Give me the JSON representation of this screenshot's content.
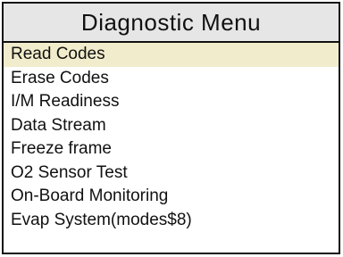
{
  "header": {
    "title": "Diagnostic Menu"
  },
  "menu": {
    "selected_index": 0,
    "items": [
      {
        "label": "Read Codes"
      },
      {
        "label": "Erase Codes"
      },
      {
        "label": "I/M Readiness"
      },
      {
        "label": "Data Stream"
      },
      {
        "label": "Freeze frame"
      },
      {
        "label": "O2 Sensor Test"
      },
      {
        "label": "On-Board Monitoring"
      },
      {
        "label": "Evap System(modes$8)"
      }
    ]
  },
  "colors": {
    "background": "#ffffff",
    "title_bar": "#e6e6e6",
    "selection_highlight": "#f1eccb",
    "text": "#111111",
    "border": "#111111"
  }
}
